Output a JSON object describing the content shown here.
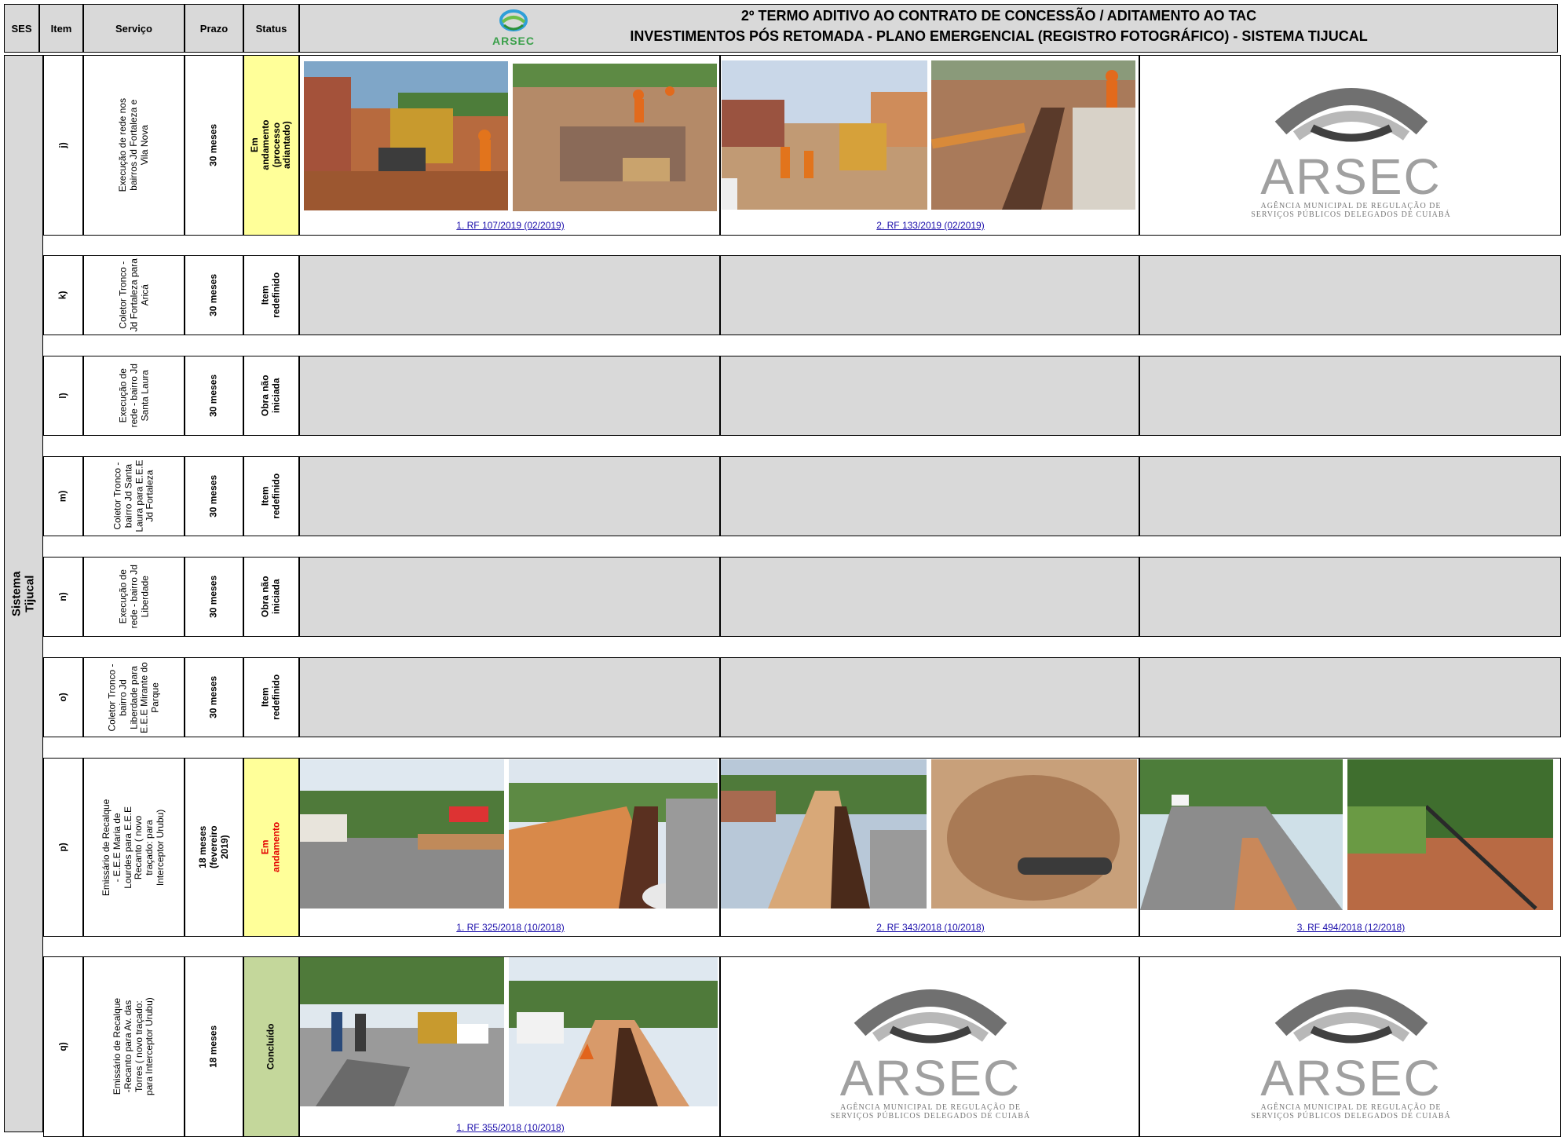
{
  "header": {
    "col_ses": "SES",
    "col_item": "Item",
    "col_servico": "Serviço",
    "col_prazo": "Prazo",
    "col_status": "Status",
    "title_line1": "2º TERMO ADITIVO AO CONTRATO DE CONCESSÃO / ADITAMENTO AO TAC",
    "title_line2": "INVESTIMENTOS PÓS RETOMADA - PLANO EMERGENCIAL (REGISTRO FOTOGRÁFICO) - SISTEMA TIJUCAL",
    "logo_text": "ARSEC"
  },
  "ses_label": "Sistema Tijucal",
  "logo": {
    "word": "ARSEC",
    "sub": "AGÊNCIA MUNICIPAL DE REGULAÇÃO DE\nSERVIÇOS PÚBLICOS DELEGADOS DE CUIABÁ"
  },
  "rows": [
    {
      "item": "j)",
      "servico": "Execução de rede nos bairros Jd Fortaleza e Vila Nova",
      "prazo": "30 meses",
      "status": "Em andamento (processo adiantado)",
      "links": [
        "1. RF 107/2019 (02/2019)",
        "2. RF 133/2019 (02/2019)"
      ]
    },
    {
      "item": "k)",
      "servico": "Coletor Tronco - Jd Fortaleza para Aricá",
      "prazo": "30 meses",
      "status": "Item redefinido"
    },
    {
      "item": "l)",
      "servico": "Execução de rede - bairro Jd Santa Laura",
      "prazo": "30 meses",
      "status": "Obra não iniciada"
    },
    {
      "item": "m)",
      "servico": "Coletor Tronco - bairro Jd Santa Laura para E.E.E Jd Fortaleza",
      "prazo": "30 meses",
      "status": "Item redefinido"
    },
    {
      "item": "n)",
      "servico": "Execução de rede - bairro Jd Liberdade",
      "prazo": "30 meses",
      "status": "Obra não iniciada"
    },
    {
      "item": "o)",
      "servico": "Coletor Tronco - bairro Jd Liberdade para E.E.E Mirante do Parque",
      "prazo": "30 meses",
      "status": "Item redefinido"
    },
    {
      "item": "p)",
      "servico": "Emissário de Recalque - E.E.E Maria de Lourdes para E.E.E Recanto ( novo traçado: para Interceptor Urubu)",
      "prazo": "18 meses (fevereiro 2019)",
      "status": "Em andamento",
      "links": [
        "1. RF 325/2018 (10/2018)",
        "2. RF 343/2018 (10/2018)",
        "3. RF 494/2018 (12/2018)"
      ]
    },
    {
      "item": "q)",
      "servico": "Emissário de Recalque -Recanto para Av. das Torres ( novo traçado: para Interceptor Urubu)",
      "prazo": "18 meses",
      "status": "Concluído",
      "links": [
        "1. RF 355/2018 (10/2018)"
      ]
    }
  ],
  "colors": {
    "header_gray": "#d9d9d9",
    "status_yellow": "#ffff99",
    "status_green": "#c4d79b",
    "status_red_text": "#e30000",
    "link_blue": "#1a0dab"
  }
}
